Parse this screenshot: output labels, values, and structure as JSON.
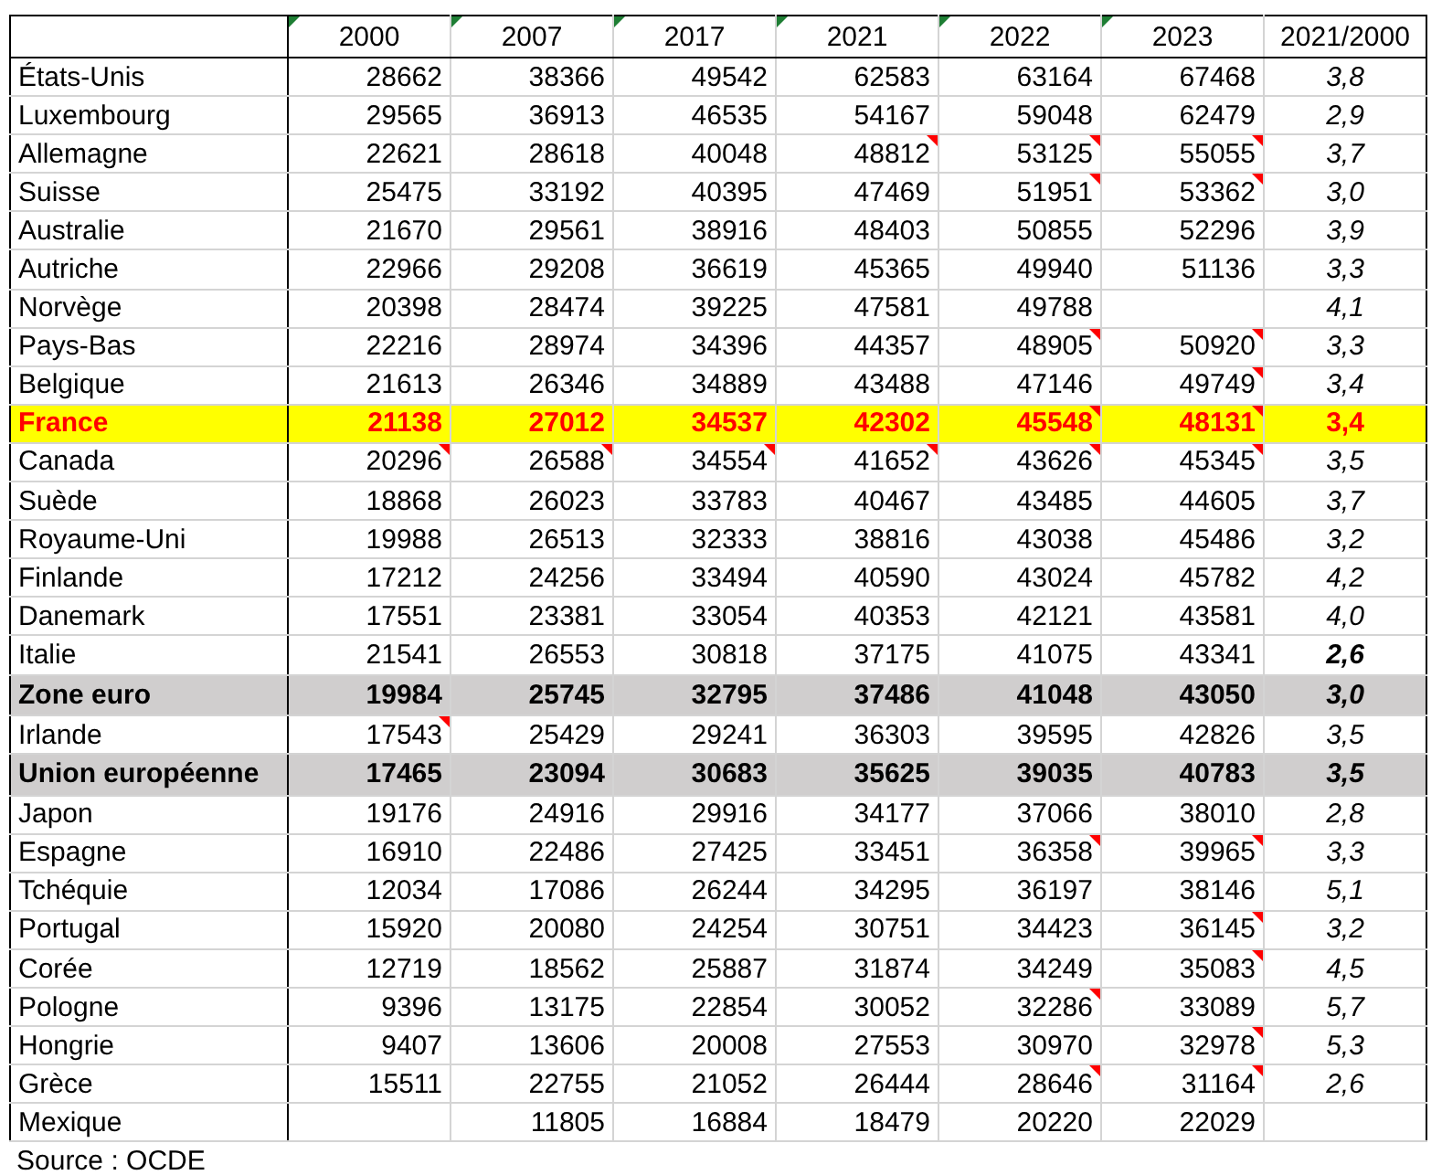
{
  "table": {
    "columns": [
      {
        "label": "2000",
        "flagged": true
      },
      {
        "label": "2007",
        "flagged": true
      },
      {
        "label": "2017",
        "flagged": true
      },
      {
        "label": "2021",
        "flagged": true
      },
      {
        "label": "2022",
        "flagged": true
      },
      {
        "label": "2023",
        "flagged": true
      },
      {
        "label": "2021/2000",
        "flagged": false
      }
    ],
    "rows": [
      {
        "name": "États-Unis",
        "kind": "country",
        "cells": [
          {
            "value": "28662",
            "comment": false
          },
          {
            "value": "38366",
            "comment": false
          },
          {
            "value": "49542",
            "comment": false
          },
          {
            "value": "62583",
            "comment": false
          },
          {
            "value": "63164",
            "comment": false
          },
          {
            "value": "67468",
            "comment": false
          }
        ],
        "ratio": {
          "value": "3,8",
          "bold": false
        }
      },
      {
        "name": "Luxembourg",
        "kind": "country",
        "cells": [
          {
            "value": "29565",
            "comment": false
          },
          {
            "value": "36913",
            "comment": false
          },
          {
            "value": "46535",
            "comment": false
          },
          {
            "value": "54167",
            "comment": false
          },
          {
            "value": "59048",
            "comment": false
          },
          {
            "value": "62479",
            "comment": false
          }
        ],
        "ratio": {
          "value": "2,9",
          "bold": false
        }
      },
      {
        "name": "Allemagne",
        "kind": "country",
        "cells": [
          {
            "value": "22621",
            "comment": false
          },
          {
            "value": "28618",
            "comment": false
          },
          {
            "value": "40048",
            "comment": false
          },
          {
            "value": "48812",
            "comment": true
          },
          {
            "value": "53125",
            "comment": true
          },
          {
            "value": "55055",
            "comment": true
          }
        ],
        "ratio": {
          "value": "3,7",
          "bold": false
        }
      },
      {
        "name": "Suisse",
        "kind": "country",
        "cells": [
          {
            "value": "25475",
            "comment": false
          },
          {
            "value": "33192",
            "comment": false
          },
          {
            "value": "40395",
            "comment": false
          },
          {
            "value": "47469",
            "comment": false
          },
          {
            "value": "51951",
            "comment": true
          },
          {
            "value": "53362",
            "comment": true
          }
        ],
        "ratio": {
          "value": "3,0",
          "bold": false
        }
      },
      {
        "name": "Australie",
        "kind": "country",
        "cells": [
          {
            "value": "21670",
            "comment": false
          },
          {
            "value": "29561",
            "comment": false
          },
          {
            "value": "38916",
            "comment": false
          },
          {
            "value": "48403",
            "comment": false
          },
          {
            "value": "50855",
            "comment": false
          },
          {
            "value": "52296",
            "comment": false
          }
        ],
        "ratio": {
          "value": "3,9",
          "bold": false
        }
      },
      {
        "name": "Autriche",
        "kind": "country",
        "cells": [
          {
            "value": "22966",
            "comment": false
          },
          {
            "value": "29208",
            "comment": false
          },
          {
            "value": "36619",
            "comment": false
          },
          {
            "value": "45365",
            "comment": false
          },
          {
            "value": "49940",
            "comment": false
          },
          {
            "value": "51136",
            "comment": false
          }
        ],
        "ratio": {
          "value": "3,3",
          "bold": false
        }
      },
      {
        "name": "Norvège",
        "kind": "country",
        "cells": [
          {
            "value": "20398",
            "comment": false
          },
          {
            "value": "28474",
            "comment": false
          },
          {
            "value": "39225",
            "comment": false
          },
          {
            "value": "47581",
            "comment": false
          },
          {
            "value": "49788",
            "comment": false
          },
          {
            "comment": false
          }
        ],
        "ratio": {
          "value": "4,1",
          "bold": false
        }
      },
      {
        "name": "Pays-Bas",
        "kind": "country",
        "cells": [
          {
            "value": "22216",
            "comment": false
          },
          {
            "value": "28974",
            "comment": false
          },
          {
            "value": "34396",
            "comment": false
          },
          {
            "value": "44357",
            "comment": false
          },
          {
            "value": "48905",
            "comment": true
          },
          {
            "value": "50920",
            "comment": true
          }
        ],
        "ratio": {
          "value": "3,3",
          "bold": false
        }
      },
      {
        "name": "Belgique",
        "kind": "country",
        "cells": [
          {
            "value": "21613",
            "comment": false
          },
          {
            "value": "26346",
            "comment": false
          },
          {
            "value": "34889",
            "comment": false
          },
          {
            "value": "43488",
            "comment": false
          },
          {
            "value": "47146",
            "comment": false
          },
          {
            "value": "49749",
            "comment": true
          }
        ],
        "ratio": {
          "value": "3,4",
          "bold": false
        }
      },
      {
        "name": "France",
        "kind": "highlight",
        "cells": [
          {
            "value": "21138",
            "comment": false
          },
          {
            "value": "27012",
            "comment": false
          },
          {
            "value": "34537",
            "comment": false
          },
          {
            "value": "42302",
            "comment": false
          },
          {
            "value": "45548",
            "comment": true
          },
          {
            "value": "48131",
            "comment": true
          }
        ],
        "ratio": {
          "value": "3,4",
          "bold": true
        }
      },
      {
        "name": "Canada",
        "kind": "country",
        "cells": [
          {
            "value": "20296",
            "comment": true
          },
          {
            "value": "26588",
            "comment": true
          },
          {
            "value": "34554",
            "comment": true
          },
          {
            "value": "41652",
            "comment": true
          },
          {
            "value": "43626",
            "comment": true
          },
          {
            "value": "45345",
            "comment": true
          }
        ],
        "ratio": {
          "value": "3,5",
          "bold": false
        }
      },
      {
        "name": "Suède",
        "kind": "country",
        "cells": [
          {
            "value": "18868",
            "comment": false
          },
          {
            "value": "26023",
            "comment": false
          },
          {
            "value": "33783",
            "comment": false
          },
          {
            "value": "40467",
            "comment": false
          },
          {
            "value": "43485",
            "comment": false
          },
          {
            "value": "44605",
            "comment": false
          }
        ],
        "ratio": {
          "value": "3,7",
          "bold": false
        }
      },
      {
        "name": "Royaume-Uni",
        "kind": "country",
        "cells": [
          {
            "value": "19988",
            "comment": false
          },
          {
            "value": "26513",
            "comment": false
          },
          {
            "value": "32333",
            "comment": false
          },
          {
            "value": "38816",
            "comment": false
          },
          {
            "value": "43038",
            "comment": false
          },
          {
            "value": "45486",
            "comment": false
          }
        ],
        "ratio": {
          "value": "3,2",
          "bold": false
        }
      },
      {
        "name": "Finlande",
        "kind": "country",
        "cells": [
          {
            "value": "17212",
            "comment": false
          },
          {
            "value": "24256",
            "comment": false
          },
          {
            "value": "33494",
            "comment": false
          },
          {
            "value": "40590",
            "comment": false
          },
          {
            "value": "43024",
            "comment": false
          },
          {
            "value": "45782",
            "comment": false
          }
        ],
        "ratio": {
          "value": "4,2",
          "bold": false
        }
      },
      {
        "name": "Danemark",
        "kind": "country",
        "cells": [
          {
            "value": "17551",
            "comment": false
          },
          {
            "value": "23381",
            "comment": false
          },
          {
            "value": "33054",
            "comment": false
          },
          {
            "value": "40353",
            "comment": false
          },
          {
            "value": "42121",
            "comment": false
          },
          {
            "value": "43581",
            "comment": false
          }
        ],
        "ratio": {
          "value": "4,0",
          "bold": false
        }
      },
      {
        "name": "Italie",
        "kind": "country",
        "cells": [
          {
            "value": "21541",
            "comment": false
          },
          {
            "value": "26553",
            "comment": false
          },
          {
            "value": "30818",
            "comment": false
          },
          {
            "value": "37175",
            "comment": false
          },
          {
            "value": "41075",
            "comment": false
          },
          {
            "value": "43341",
            "comment": false
          }
        ],
        "ratio": {
          "value": "2,6",
          "bold": true
        }
      },
      {
        "name": "Zone euro",
        "kind": "aggregate",
        "cells": [
          {
            "value": "19984",
            "comment": false
          },
          {
            "value": "25745",
            "comment": false
          },
          {
            "value": "32795",
            "comment": false
          },
          {
            "value": "37486",
            "comment": false
          },
          {
            "value": "41048",
            "comment": false
          },
          {
            "value": "43050",
            "comment": false
          }
        ],
        "ratio": {
          "value": "3,0",
          "bold": true
        }
      },
      {
        "name": "Irlande",
        "kind": "country",
        "cells": [
          {
            "value": "17543",
            "comment": true
          },
          {
            "value": "25429",
            "comment": false
          },
          {
            "value": "29241",
            "comment": false
          },
          {
            "value": "36303",
            "comment": false
          },
          {
            "value": "39595",
            "comment": false
          },
          {
            "value": "42826",
            "comment": false
          }
        ],
        "ratio": {
          "value": "3,5",
          "bold": false
        }
      },
      {
        "name": "Union européenne",
        "kind": "aggregate",
        "cells": [
          {
            "value": "17465",
            "comment": false
          },
          {
            "value": "23094",
            "comment": false
          },
          {
            "value": "30683",
            "comment": false
          },
          {
            "value": "35625",
            "comment": false
          },
          {
            "value": "39035",
            "comment": false
          },
          {
            "value": "40783",
            "comment": false
          }
        ],
        "ratio": {
          "value": "3,5",
          "bold": true
        }
      },
      {
        "name": "Japon",
        "kind": "country",
        "cells": [
          {
            "value": "19176",
            "comment": false
          },
          {
            "value": "24916",
            "comment": false
          },
          {
            "value": "29916",
            "comment": false
          },
          {
            "value": "34177",
            "comment": false
          },
          {
            "value": "37066",
            "comment": false
          },
          {
            "value": "38010",
            "comment": false
          }
        ],
        "ratio": {
          "value": "2,8",
          "bold": false
        }
      },
      {
        "name": "Espagne",
        "kind": "country",
        "cells": [
          {
            "value": "16910",
            "comment": false
          },
          {
            "value": "22486",
            "comment": false
          },
          {
            "value": "27425",
            "comment": false
          },
          {
            "value": "33451",
            "comment": false
          },
          {
            "value": "36358",
            "comment": true
          },
          {
            "value": "39965",
            "comment": true
          }
        ],
        "ratio": {
          "value": "3,3",
          "bold": false
        }
      },
      {
        "name": "Tchéquie",
        "kind": "country",
        "cells": [
          {
            "value": "12034",
            "comment": false
          },
          {
            "value": "17086",
            "comment": false
          },
          {
            "value": "26244",
            "comment": false
          },
          {
            "value": "34295",
            "comment": false
          },
          {
            "value": "36197",
            "comment": false
          },
          {
            "value": "38146",
            "comment": false
          }
        ],
        "ratio": {
          "value": "5,1",
          "bold": false
        }
      },
      {
        "name": "Portugal",
        "kind": "country",
        "cells": [
          {
            "value": "15920",
            "comment": false
          },
          {
            "value": "20080",
            "comment": false
          },
          {
            "value": "24254",
            "comment": false
          },
          {
            "value": "30751",
            "comment": false
          },
          {
            "value": "34423",
            "comment": false
          },
          {
            "value": "36145",
            "comment": true
          }
        ],
        "ratio": {
          "value": "3,2",
          "bold": false
        }
      },
      {
        "name": "Corée",
        "kind": "country",
        "cells": [
          {
            "value": "12719",
            "comment": false
          },
          {
            "value": "18562",
            "comment": false
          },
          {
            "value": "25887",
            "comment": false
          },
          {
            "value": "31874",
            "comment": false
          },
          {
            "value": "34249",
            "comment": false
          },
          {
            "value": "35083",
            "comment": true
          }
        ],
        "ratio": {
          "value": "4,5",
          "bold": false
        }
      },
      {
        "name": "Pologne",
        "kind": "country",
        "cells": [
          {
            "value": "9396",
            "comment": false
          },
          {
            "value": "13175",
            "comment": false
          },
          {
            "value": "22854",
            "comment": false
          },
          {
            "value": "30052",
            "comment": false
          },
          {
            "value": "32286",
            "comment": true
          },
          {
            "value": "33089",
            "comment": false
          }
        ],
        "ratio": {
          "value": "5,7",
          "bold": false
        }
      },
      {
        "name": "Hongrie",
        "kind": "country",
        "cells": [
          {
            "value": "9407",
            "comment": false
          },
          {
            "value": "13606",
            "comment": false
          },
          {
            "value": "20008",
            "comment": false
          },
          {
            "value": "27553",
            "comment": false
          },
          {
            "value": "30970",
            "comment": false
          },
          {
            "value": "32978",
            "comment": true
          }
        ],
        "ratio": {
          "value": "5,3",
          "bold": false
        }
      },
      {
        "name": "Grèce",
        "kind": "country",
        "cells": [
          {
            "value": "15511",
            "comment": false
          },
          {
            "value": "22755",
            "comment": false
          },
          {
            "value": "21052",
            "comment": false
          },
          {
            "value": "26444",
            "comment": false
          },
          {
            "value": "28646",
            "comment": true
          },
          {
            "value": "31164",
            "comment": true
          }
        ],
        "ratio": {
          "value": "2,6",
          "bold": false
        }
      },
      {
        "name": "Mexique",
        "kind": "country",
        "cells": [
          {
            "comment": false
          },
          {
            "value": "11805",
            "comment": false
          },
          {
            "value": "16884",
            "comment": false
          },
          {
            "value": "18479",
            "comment": false
          },
          {
            "value": "20220",
            "comment": false
          },
          {
            "value": "22029",
            "comment": false
          }
        ]
      }
    ]
  },
  "source": "Source : OCDE"
}
